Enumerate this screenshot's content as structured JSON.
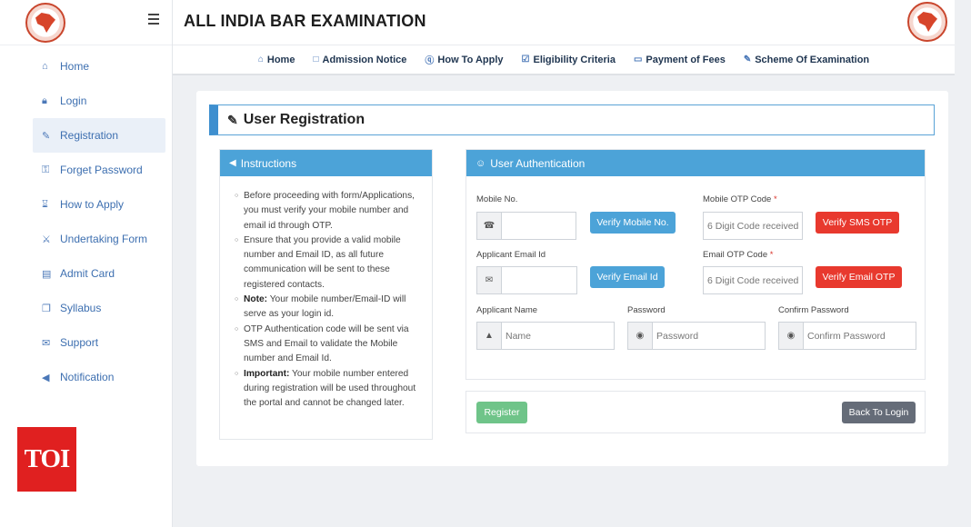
{
  "header": {
    "title": "ALL INDIA BAR EXAMINATION"
  },
  "sidebar": {
    "items": [
      {
        "label": "Home",
        "icon": "home-icon"
      },
      {
        "label": "Login",
        "icon": "lock-icon"
      },
      {
        "label": "Registration",
        "icon": "edit-icon",
        "active": true
      },
      {
        "label": "Forget Password",
        "icon": "key-icon"
      },
      {
        "label": "How to Apply",
        "icon": "hourglass-icon"
      },
      {
        "label": "Undertaking Form",
        "icon": "handshake-icon"
      },
      {
        "label": "Admit Card",
        "icon": "id-card-icon"
      },
      {
        "label": "Syllabus",
        "icon": "copy-icon"
      },
      {
        "label": "Support",
        "icon": "chat-icon"
      },
      {
        "label": "Notification",
        "icon": "bullhorn-icon"
      }
    ]
  },
  "topnav": [
    {
      "label": "Home",
      "icon": "home-icon"
    },
    {
      "label": "Admission Notice",
      "icon": "file-icon"
    },
    {
      "label": "How To Apply",
      "icon": "question-icon"
    },
    {
      "label": "Eligibility Criteria",
      "icon": "check-square-icon"
    },
    {
      "label": "Payment of Fees",
      "icon": "credit-card-icon"
    },
    {
      "label": "Scheme Of Examination",
      "icon": "edit-icon"
    }
  ],
  "page": {
    "title": "User Registration"
  },
  "instructions": {
    "title": "Instructions",
    "items": [
      {
        "bold": "",
        "text": "Before proceeding with form/Applications, you must verify your mobile number and email id through OTP."
      },
      {
        "bold": "",
        "text": "Ensure that you provide a valid mobile number and Email ID, as all future communication will be sent to these registered contacts."
      },
      {
        "bold": "Note:",
        "text": "Your mobile number/Email-ID will serve as your login id."
      },
      {
        "bold": "",
        "text": "OTP Authentication code will be sent via SMS and Email to validate the Mobile number and Email Id."
      },
      {
        "bold": "Important:",
        "text": "Your mobile number entered during registration will be used throughout the portal and cannot be changed later."
      }
    ]
  },
  "auth": {
    "title": "User Authentication",
    "mobile_label": "Mobile No.",
    "mobile_value": "",
    "verify_mobile": "Verify Mobile No.",
    "mobile_otp_label": "Mobile OTP Code",
    "mobile_otp_placeholder": "6 Digit Code received",
    "verify_sms": "Verify SMS OTP",
    "email_label": "Applicant Email Id",
    "email_value": "",
    "verify_email": "Verify Email Id",
    "email_otp_label": "Email OTP Code",
    "email_otp_placeholder": "6 Digit Code received",
    "verify_email_otp": "Verify Email OTP",
    "name_label": "Applicant Name",
    "name_placeholder": "Name",
    "password_label": "Password",
    "password_placeholder": "Password",
    "confirm_label": "Confirm Password",
    "confirm_placeholder": "Confirm Password",
    "required_mark": "*"
  },
  "actions": {
    "register": "Register",
    "back": "Back To Login"
  },
  "watermark": {
    "text": "TOI"
  },
  "colors": {
    "primary": "#4ca3d8",
    "danger": "#e8392e",
    "success": "#6fc489",
    "secondary": "#656c78",
    "accent": "#3e8fcf"
  }
}
